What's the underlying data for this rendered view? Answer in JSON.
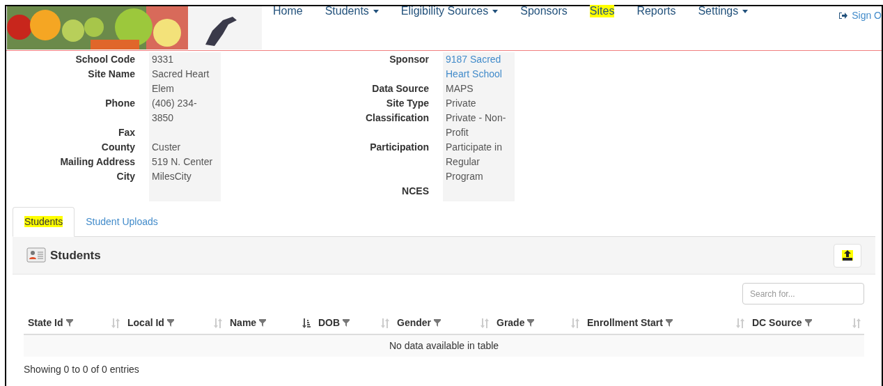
{
  "nav": {
    "items": [
      {
        "label": "Home",
        "dropdown": false,
        "highlighted": false
      },
      {
        "label": "Students",
        "dropdown": true,
        "highlighted": false
      },
      {
        "label": "Eligibility Sources",
        "dropdown": true,
        "highlighted": false
      },
      {
        "label": "Sponsors",
        "dropdown": false,
        "highlighted": false
      },
      {
        "label": "Sites",
        "dropdown": false,
        "highlighted": true
      },
      {
        "label": "Reports",
        "dropdown": false,
        "highlighted": false
      },
      {
        "label": "Settings",
        "dropdown": true,
        "highlighted": false
      }
    ],
    "sign_out": "Sign O"
  },
  "details_left": [
    {
      "label": "School Code",
      "value": "9331"
    },
    {
      "label": "Site Name",
      "value": "Sacred Heart Elem"
    },
    {
      "label": "Phone",
      "value": "(406) 234-3850"
    },
    {
      "label": "Fax"
    },
    {
      "label": "County",
      "value": "Custer"
    },
    {
      "label": "Mailing Address",
      "value": "519 N. Center"
    },
    {
      "label": "City",
      "value": "MilesCity"
    }
  ],
  "details_right": [
    {
      "label": "Sponsor",
      "value": "9187 Sacred Heart School",
      "kind": "link"
    },
    {
      "label": "Data Source",
      "value": "MAPS",
      "kind": "text"
    },
    {
      "label": "Site Type",
      "value": "Private",
      "kind": "text"
    },
    {
      "label": "Classification",
      "value": "Private - Non-Profit",
      "kind": "text"
    },
    {
      "label": "Participation",
      "value": "Participate in Regular Program",
      "kind": "text"
    },
    {
      "label": "NCES"
    }
  ],
  "tabs": [
    {
      "label": "Students",
      "selected": true,
      "highlighted": true
    },
    {
      "label": "Student Uploads",
      "selected": false,
      "highlighted": false
    }
  ],
  "panel": {
    "title": "Students",
    "upload_highlighted": true
  },
  "search": {
    "placeholder": "Search for..."
  },
  "table": {
    "columns": [
      {
        "label": "State Id",
        "sorted": false
      },
      {
        "label": "Local Id",
        "sorted": false
      },
      {
        "label": "Name",
        "sorted": true
      },
      {
        "label": "DOB",
        "sorted": false
      },
      {
        "label": "Gender",
        "sorted": false
      },
      {
        "label": "Grade",
        "sorted": false
      },
      {
        "label": "Enrollment Start",
        "sorted": false
      },
      {
        "label": "DC Source",
        "sorted": false
      }
    ],
    "empty_message": "No data available in table"
  },
  "footer": {
    "info": "Showing 0 to 0 of 0 entries"
  }
}
